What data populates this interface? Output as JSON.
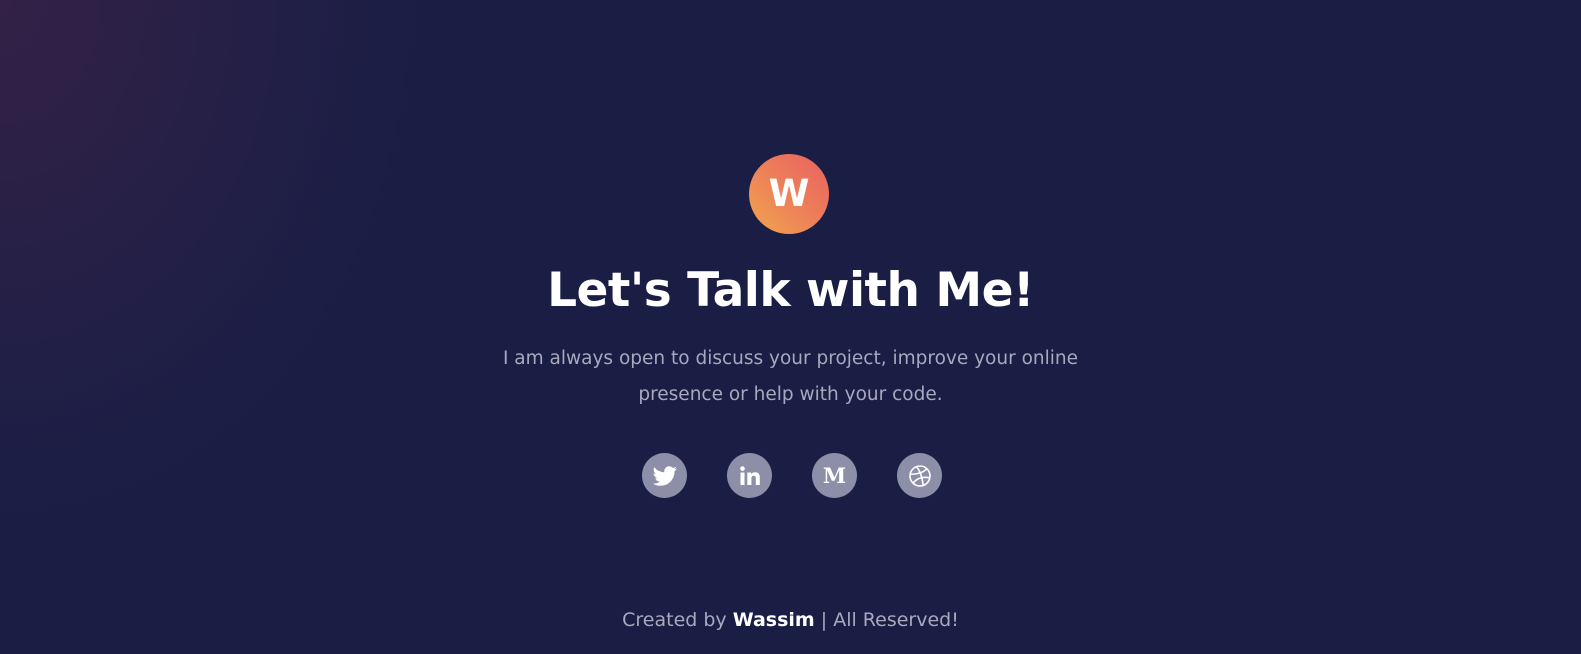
{
  "logo": {
    "letter": "W"
  },
  "hero": {
    "title": "Let's Talk with Me!",
    "subtitle": "I am always open to discuss your project, improve your online presence or help with your code."
  },
  "socials": [
    {
      "icon": "twitter-icon",
      "label": "Twitter"
    },
    {
      "icon": "linkedin-icon",
      "label": "LinkedIn",
      "glyph": "in"
    },
    {
      "icon": "medium-icon",
      "label": "Medium",
      "glyph": "M"
    },
    {
      "icon": "dribbble-icon",
      "label": "Dribbble"
    }
  ],
  "footer": {
    "prefix": "Created by ",
    "author": "Wassim",
    "suffix": " | All Reserved!"
  },
  "colors": {
    "background": "#1a1e45",
    "accent_gradient_start": "#f2a54e",
    "accent_gradient_end": "#e9625f",
    "social_circle": "#8d8fa8",
    "muted_text": "#a8a8be"
  }
}
